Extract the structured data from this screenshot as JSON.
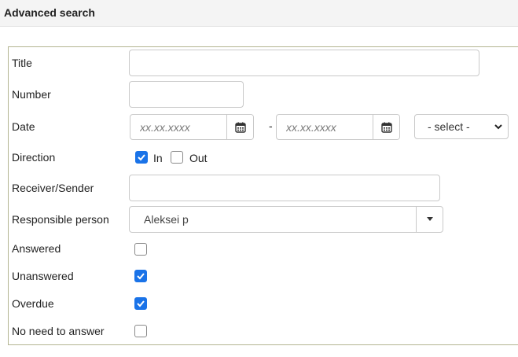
{
  "header": {
    "title": "Advanced search"
  },
  "form": {
    "title_label": "Title",
    "title_value": "",
    "number_label": "Number",
    "number_value": "",
    "date_label": "Date",
    "date_from_placeholder": "xx.xx.xxxx",
    "date_separator": "-",
    "date_to_placeholder": "xx.xx.xxxx",
    "date_select_value": "- select -",
    "direction_label": "Direction",
    "direction_in_label": "In",
    "direction_in_checked": true,
    "direction_out_label": "Out",
    "direction_out_checked": false,
    "receiver_label": "Receiver/Sender",
    "receiver_value": "",
    "responsible_label": "Responsible person",
    "responsible_value": "Aleksei p",
    "answered_label": "Answered",
    "answered_checked": false,
    "unanswered_label": "Unanswered",
    "unanswered_checked": true,
    "overdue_label": "Overdue",
    "overdue_checked": true,
    "no_need_label": "No need to answer",
    "no_need_checked": false
  },
  "colors": {
    "accent": "#1a73e8",
    "panel_border": "#b3b591",
    "header_bg": "#f4f4f4"
  },
  "icons": {
    "calendar": "calendar-icon",
    "chevron": "chevron-down-icon",
    "caret": "caret-down-icon",
    "check": "check-icon"
  }
}
